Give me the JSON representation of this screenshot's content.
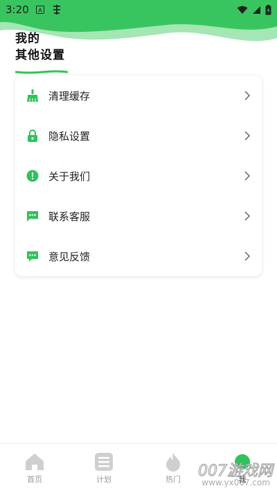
{
  "status_bar": {
    "time": "3:20"
  },
  "header": {
    "line1": "我的",
    "line2": "其他设置"
  },
  "colors": {
    "accent": "#2fc35a",
    "wave_light": "#a4e6b4",
    "wave_dark": "#33c05a"
  },
  "menu": [
    {
      "label": "清理缓存",
      "icon": "broom-icon"
    },
    {
      "label": "隐私设置",
      "icon": "lock-icon"
    },
    {
      "label": "关于我们",
      "icon": "info-icon"
    },
    {
      "label": "联系客服",
      "icon": "chat-dots-icon"
    },
    {
      "label": "意见反馈",
      "icon": "feedback-icon"
    }
  ],
  "bottom_nav": [
    {
      "label": "首页",
      "icon": "home-icon"
    },
    {
      "label": "计划",
      "icon": "list-icon"
    },
    {
      "label": "热门",
      "icon": "flame-icon"
    },
    {
      "label": "我",
      "icon": "profile-dot-icon",
      "active": true
    }
  ],
  "watermark": {
    "text": "007游戏网",
    "url": "www.yx007.com"
  }
}
